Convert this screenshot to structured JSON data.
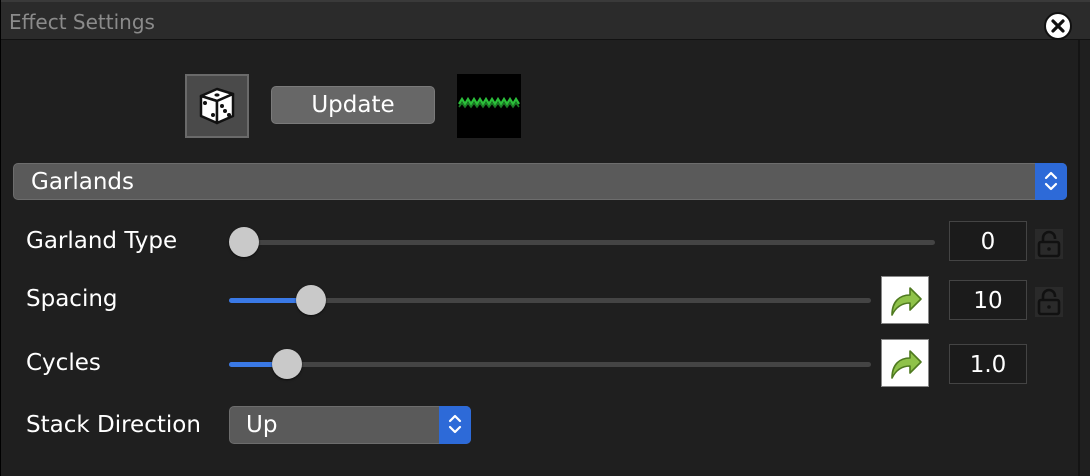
{
  "window": {
    "title": "Effect Settings",
    "close_icon": "close-x-icon"
  },
  "toolbar": {
    "randomize_icon": "dice-icon",
    "update_label": "Update",
    "preview_icon": "garland-preview-icon"
  },
  "effect": {
    "selected": "Garlands"
  },
  "rows": {
    "garland_type": {
      "label": "Garland Type",
      "value": "0",
      "fraction": 0.0
    },
    "spacing": {
      "label": "Spacing",
      "value": "10",
      "fraction": 0.11
    },
    "cycles": {
      "label": "Cycles",
      "value": "1.0",
      "fraction": 0.07
    },
    "stack_direction": {
      "label": "Stack Direction",
      "value": "Up"
    }
  },
  "colors": {
    "accent": "#3a79e6",
    "stepper": "#2d6ad8",
    "preview_wave": "#2bbf3a"
  }
}
